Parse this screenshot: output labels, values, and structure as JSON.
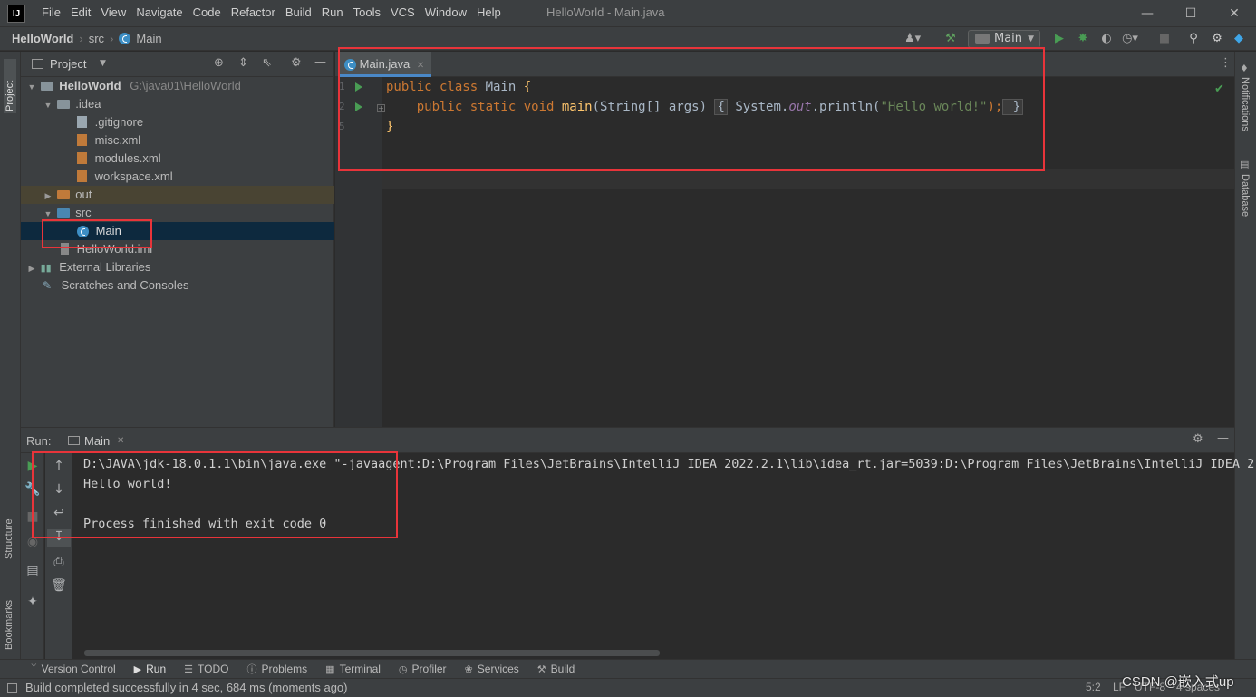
{
  "window": {
    "logo": "IJ",
    "title": "HelloWorld - Main.java",
    "menu": [
      "File",
      "Edit",
      "View",
      "Navigate",
      "Code",
      "Refactor",
      "Build",
      "Run",
      "Tools",
      "VCS",
      "Window",
      "Help"
    ]
  },
  "breadcrumb": [
    "HelloWorld",
    "src",
    "Main"
  ],
  "toolbar": {
    "run_config": "Main"
  },
  "left_strip": {
    "project": "Project",
    "structure": "Structure",
    "bookmarks": "Bookmarks"
  },
  "right_strip": {
    "notifications": "Notifications",
    "database": "Database"
  },
  "project_panel": {
    "title": "Project",
    "tree": [
      {
        "label": "HelloWorld",
        "path": "G:\\java01\\HelloWorld"
      },
      {
        "label": ".idea"
      },
      {
        "label": ".gitignore"
      },
      {
        "label": "misc.xml"
      },
      {
        "label": "modules.xml"
      },
      {
        "label": "workspace.xml"
      },
      {
        "label": "out"
      },
      {
        "label": "src"
      },
      {
        "label": "Main"
      },
      {
        "label": "HelloWorld.iml"
      },
      {
        "label": "External Libraries"
      },
      {
        "label": "Scratches and Consoles"
      }
    ]
  },
  "editor": {
    "tab_label": "Main.java",
    "line_numbers": [
      "1",
      "2",
      "5"
    ],
    "lines": {
      "l1_kw": "public class ",
      "l1_name": "Main ",
      "l1_brace": "{",
      "l2_kw": "    public static void ",
      "l2_fn": "main",
      "l2_params": "(String[] args) ",
      "l2_open": "{",
      "l2_sys": " System.",
      "l2_out": "out",
      "l2_println": ".println(",
      "l2_str": "\"Hello world!\"",
      "l2_end": ");",
      "l2_close": " }",
      "l3_brace": "}"
    }
  },
  "run_panel": {
    "label": "Run:",
    "tab": "Main",
    "console": [
      "D:\\JAVA\\jdk-18.0.1.1\\bin\\java.exe \"-javaagent:D:\\Program Files\\JetBrains\\IntelliJ IDEA 2022.2.1\\lib\\idea_rt.jar=5039:D:\\Program Files\\JetBrains\\IntelliJ IDEA 2",
      "Hello world!",
      "",
      "Process finished with exit code 0"
    ]
  },
  "bottom_tabs": [
    "Version Control",
    "Run",
    "TODO",
    "Problems",
    "Terminal",
    "Profiler",
    "Services",
    "Build"
  ],
  "status": {
    "message": "Build completed successfully in 4 sec, 684 ms (moments ago)",
    "position": "5:2",
    "line_sep": "LF",
    "encoding": "UTF-8",
    "indent": "4 spaces",
    "watermark": "CSDN @嵌入式up"
  },
  "colors": {
    "accent": "#4a88c7",
    "annotation_red": "#e8343a",
    "run_green": "#499c54"
  }
}
